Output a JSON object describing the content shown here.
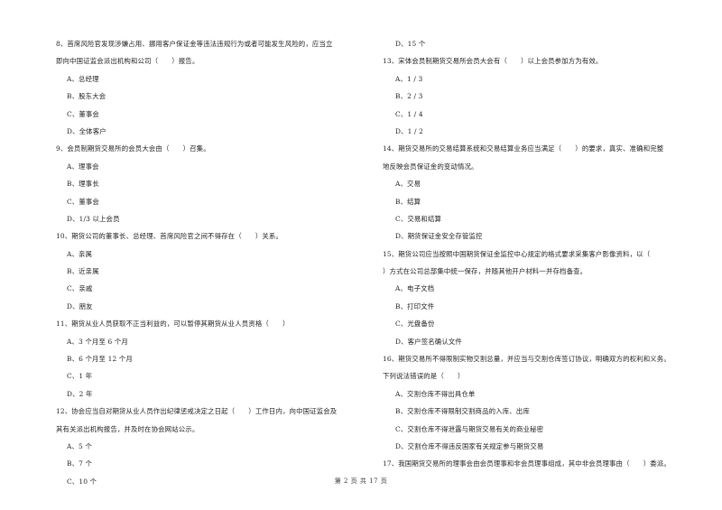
{
  "left_column": [
    {
      "type": "q",
      "text": "8、首席风险官发现涉嫌占用、挪用客户保证金等违法违规行为或者可能发生风险的，应当立"
    },
    {
      "type": "q",
      "text": "即向中国证监会派出机构和公司（　　）报告。"
    },
    {
      "type": "opt",
      "text": "A、总经理"
    },
    {
      "type": "opt",
      "text": "B、股东大会"
    },
    {
      "type": "opt",
      "text": "C、董事会"
    },
    {
      "type": "opt",
      "text": "D、全体客户"
    },
    {
      "type": "q",
      "text": "9、会员制期货交易所的会员大会由（　　）召集。"
    },
    {
      "type": "opt",
      "text": "A、理事会"
    },
    {
      "type": "opt",
      "text": "B、理事长"
    },
    {
      "type": "opt",
      "text": "C、董事会"
    },
    {
      "type": "opt",
      "text": "D、1/3 以上会员"
    },
    {
      "type": "q",
      "text": "10、期货公司的董事长、总经理、首席风险官之间不得存在（　　）关系。"
    },
    {
      "type": "opt",
      "text": "A、亲属"
    },
    {
      "type": "opt",
      "text": "B、近亲属"
    },
    {
      "type": "opt",
      "text": "C、亲戚"
    },
    {
      "type": "opt",
      "text": "D、朋友"
    },
    {
      "type": "q",
      "text": "11、期货从业人员获取不正当利益的，可以暂停其期货从业人员资格（　　）"
    },
    {
      "type": "opt",
      "text": "A、3 个月至 6 个月"
    },
    {
      "type": "opt",
      "text": "B、6 个月至 12 个月"
    },
    {
      "type": "opt",
      "text": "C、1 年"
    },
    {
      "type": "opt",
      "text": "D、2 年"
    },
    {
      "type": "q",
      "text": "12、协会应当自对期货从业人员作出纪律惩戒决定之日起（　　）工作日内，向中国证监会及"
    },
    {
      "type": "q",
      "text": "其有关派出机构报告，并及时在协会网站公示。"
    },
    {
      "type": "opt",
      "text": "A、5 个"
    },
    {
      "type": "opt",
      "text": "B、7 个"
    },
    {
      "type": "opt",
      "text": "C、10 个"
    }
  ],
  "right_column": [
    {
      "type": "opt",
      "text": "D、15 个"
    },
    {
      "type": "q",
      "text": "13、宋体会员制期货交易所会员大会有（　　）以上会员参加方为有效。"
    },
    {
      "type": "opt",
      "text": "A、1 / 3"
    },
    {
      "type": "opt",
      "text": "B、2 / 3"
    },
    {
      "type": "opt",
      "text": "C、1 / 4"
    },
    {
      "type": "opt",
      "text": "D、1 / 2"
    },
    {
      "type": "q",
      "text": "14、期货交易所的交易结算系统和交易结算业务应当满足（　　）的要求，真实、准确和完整"
    },
    {
      "type": "q",
      "text": "地反映会员保证金的变动情况。"
    },
    {
      "type": "opt",
      "text": "A、交易"
    },
    {
      "type": "opt",
      "text": "B、结算"
    },
    {
      "type": "opt",
      "text": "C、交易和结算"
    },
    {
      "type": "opt",
      "text": "D、期货保证金安全存管监控"
    },
    {
      "type": "q",
      "text": "15、期货公司应当按照中国期货保证金监控中心规定的格式要求采集客户影像资料，以（"
    },
    {
      "type": "q",
      "text": "）方式在公司总部集中统一保存，并随其他开户材料一并存档备查。"
    },
    {
      "type": "opt",
      "text": "A、电子文档"
    },
    {
      "type": "opt",
      "text": "B、打印文件"
    },
    {
      "type": "opt",
      "text": "C、光盘备份"
    },
    {
      "type": "opt",
      "text": "D、客户签名确认文件"
    },
    {
      "type": "q",
      "text": "16、期货交易所不得限制实物交割总量，并应当与交割仓库签订协议，明确双方的权利和义务。"
    },
    {
      "type": "q",
      "text": "下列说法错误的是（　　）"
    },
    {
      "type": "opt",
      "text": "A、交割仓库不得出具仓单"
    },
    {
      "type": "opt",
      "text": "B、交割仓库不得限制交割商品的入库、出库"
    },
    {
      "type": "opt",
      "text": "C、交割仓库不得泄露与期货交易有关的商业秘密"
    },
    {
      "type": "opt",
      "text": "D、交割仓库不得违反国家有关规定参与期货交易"
    },
    {
      "type": "q",
      "text": "17、我国期货交易所的理事会由会员理事和非会员理事组成，其中非会员理事由（　　）委派。"
    }
  ],
  "footer": {
    "page_label": "第 2 页 共 17 页"
  }
}
